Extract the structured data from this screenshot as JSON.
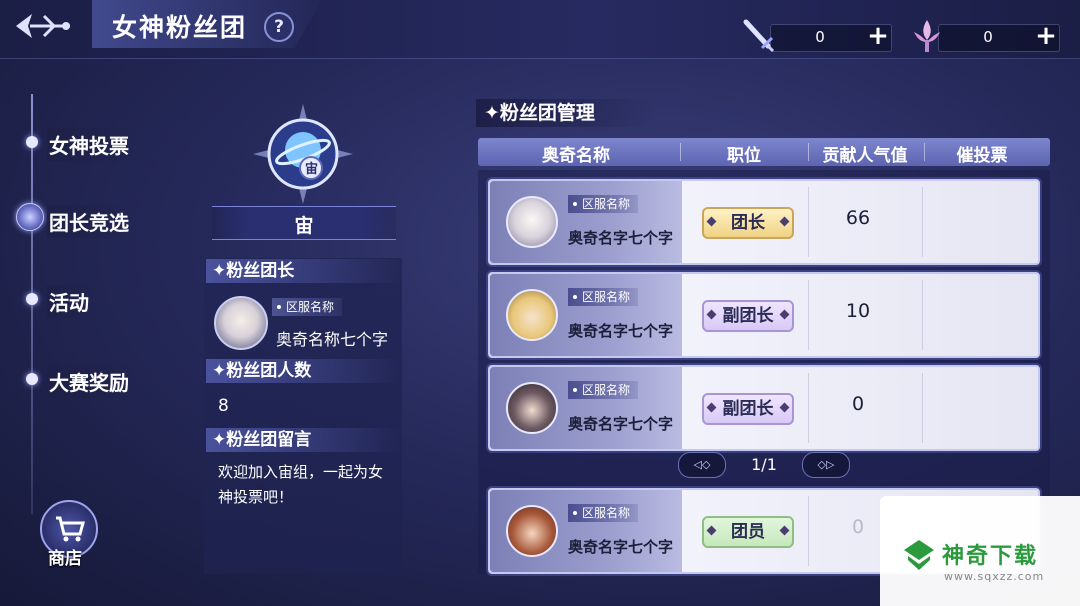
{
  "header": {
    "title": "女神粉丝团",
    "help": "?",
    "resources": [
      {
        "icon": "sword-icon",
        "value": "0",
        "plus": "+"
      },
      {
        "icon": "fleur-icon",
        "value": "0",
        "plus": "+"
      }
    ]
  },
  "nav": {
    "items": [
      {
        "label": "女神投票",
        "active": false
      },
      {
        "label": "团长竞选",
        "active": true
      },
      {
        "label": "活动",
        "active": false
      },
      {
        "label": "大赛奖励",
        "active": false
      }
    ],
    "shop_label": "商店"
  },
  "group": {
    "emblem_char": "宙",
    "name": "宙",
    "leader_head": "✦粉丝团长",
    "leader_server": "区服名称",
    "leader_name": "奥奇名称七个字",
    "count_head": "✦粉丝团人数",
    "count": "8",
    "message_head": "✦粉丝团留言",
    "message": "欢迎加入宙组，一起为女神投票吧！"
  },
  "management": {
    "title": "✦粉丝团管理",
    "columns": [
      "奥奇名称",
      "职位",
      "贡献人气值",
      "催投票"
    ],
    "rows": [
      {
        "server": "区服名称",
        "name": "奥奇名字七个字",
        "role": "团长",
        "role_type": "leader",
        "popularity": "66",
        "avatar_color": "#e9e4ee"
      },
      {
        "server": "区服名称",
        "name": "奥奇名字七个字",
        "role": "副团长",
        "role_type": "vice",
        "popularity": "10",
        "avatar_color": "#e8c779"
      },
      {
        "server": "区服名称",
        "name": "奥奇名字七个字",
        "role": "副团长",
        "role_type": "vice",
        "popularity": "0",
        "avatar_color": "#4a3a40"
      },
      {
        "server": "区服名称",
        "name": "奥奇名字七个字",
        "role": "团员",
        "role_type": "member",
        "popularity": "0",
        "avatar_color": "#8a4a30"
      }
    ],
    "pager": {
      "text": "1/1",
      "prev": "◁◇",
      "next": "◇▷"
    }
  },
  "watermark": {
    "text": "神奇下载",
    "url": "www.sqxzz.com"
  }
}
